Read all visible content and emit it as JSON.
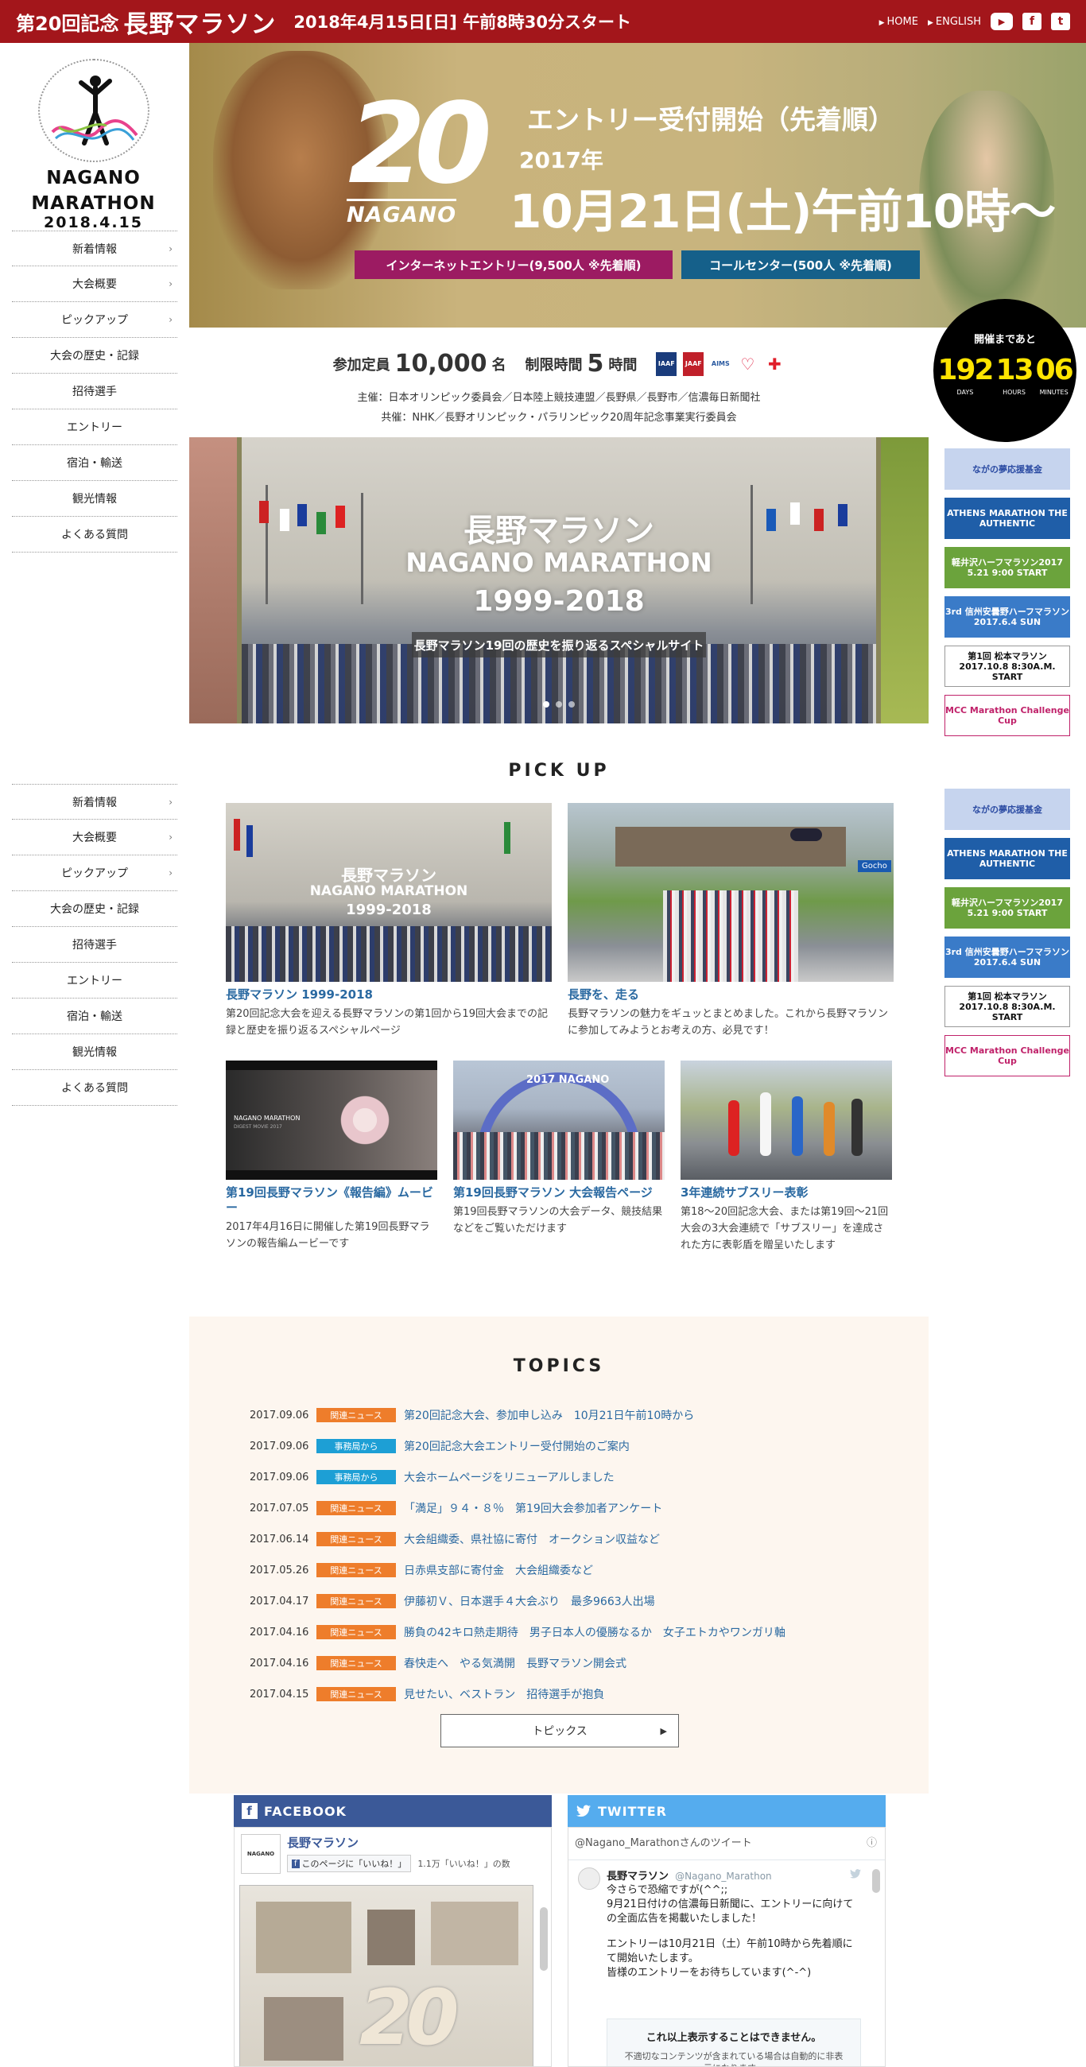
{
  "header": {
    "title_prefix": "第20回記念",
    "title_main": "長野マラソン",
    "date_text": "2018年4月15日[日] 午前8時30分スタート",
    "link_home": "HOME",
    "link_english": "ENGLISH",
    "youtube_label": "▶",
    "facebook_label": "f",
    "twitter_label": "t"
  },
  "logo": {
    "line1": "NAGANO",
    "line2": "MARATHON",
    "line3": "2018.4.15"
  },
  "nav": {
    "items": [
      {
        "label": "新着情報",
        "chevron": true
      },
      {
        "label": "大会概要",
        "chevron": true
      },
      {
        "label": "ピックアップ",
        "chevron": true
      },
      {
        "label": "大会の歴史・記録",
        "chevron": false
      },
      {
        "label": "招待選手",
        "chevron": false
      },
      {
        "label": "エントリー",
        "chevron": false
      },
      {
        "label": "宿泊・輸送",
        "chevron": false
      },
      {
        "label": "観光情報",
        "chevron": false
      },
      {
        "label": "よくある質問",
        "chevron": false
      }
    ],
    "chevron_glyph": "›"
  },
  "hero": {
    "big_number": "20",
    "nagano_word": "NAGANO",
    "headline": "エントリー受付開始（先着順）",
    "year": "2017年",
    "date_time": "10月21日(土)午前10時～",
    "btn_internet": "インターネットエントリー(9,500人 ※先着順)",
    "btn_callcenter": "コールセンター(500人 ※先着順)"
  },
  "countdown": {
    "label": "開催まであと",
    "days": "192",
    "hours": "13",
    "minutes": "06",
    "unit_days": "DAYS",
    "unit_hours": "HOURS",
    "unit_minutes": "MINUTES"
  },
  "info": {
    "capacity_label": "参加定員",
    "capacity_value": "10,000",
    "capacity_unit": "名",
    "limit_label": "制限時間",
    "limit_value": "5",
    "limit_unit": "時間",
    "organizers": "主催：日本オリンピック委員会／日本陸上競技連盟／長野県／長野市／信濃毎日新聞社",
    "cosponsors": "共催：NHK／長野オリンピック・パラリンピック20周年記念事業実行委員会",
    "logos": [
      "IAAF",
      "JAAF",
      "AIMS",
      "♡",
      "✚"
    ]
  },
  "slider": {
    "title_jp": "長野マラソン",
    "title_en": "NAGANO MARATHON",
    "years": "1999-2018",
    "caption": "長野マラソン19回の歴史を振り返るスペシャルサイト"
  },
  "pickup": {
    "title": "PICK UP",
    "cards": [
      {
        "title": "長野マラソン 1999-2018",
        "desc": "第20回記念大会を迎える長野マラソンの第1回から19回大会までの記録と歴史を振り返るスペシャルページ",
        "img_line1": "長野マラソン",
        "img_line2": "NAGANO MARATHON",
        "img_line3": "1999-2018"
      },
      {
        "title": "長野を、走る",
        "desc": "長野マラソンの魅力をギュッとまとめました。これから長野マラソンに参加してみようとお考えの方、必見です！",
        "img_sign": "Gocho"
      },
      {
        "title": "第19回長野マラソン《報告編》ムービー",
        "desc": "2017年4月16日に開催した第19回長野マラソンの報告編ムービーです",
        "img_line1": "NAGANO MARATHON",
        "img_line2": "DIGEST MOVIE 2017"
      },
      {
        "title": "第19回長野マラソン 大会報告ページ",
        "desc": "第19回長野マラソンの大会データ、競技結果などをご覧いただけます",
        "img_arch": "2017 NAGANO"
      },
      {
        "title": "3年連続サブスリー表彰",
        "desc": "第18～20回記念大会、または第19回～21回大会の3大会連続で「サブスリー」を達成された方に表彰盾を贈呈いたします"
      }
    ]
  },
  "topics": {
    "title": "TOPICS",
    "more_label": "トピックス",
    "more_arrow": "▶",
    "items": [
      {
        "date": "2017.09.06",
        "badge": "関連ニュース",
        "badge_color": "#ee7d2b",
        "text": "第20回記念大会、参加申し込み　10月21日午前10時から"
      },
      {
        "date": "2017.09.06",
        "badge": "事務局から",
        "badge_color": "#1d9fd5",
        "text": "第20回記念大会エントリー受付開始のご案内"
      },
      {
        "date": "2017.09.06",
        "badge": "事務局から",
        "badge_color": "#1d9fd5",
        "text": "大会ホームページをリニューアルしました"
      },
      {
        "date": "2017.07.05",
        "badge": "関連ニュース",
        "badge_color": "#ee7d2b",
        "text": "「満足」９４・８％　第19回大会参加者アンケート"
      },
      {
        "date": "2017.06.14",
        "badge": "関連ニュース",
        "badge_color": "#ee7d2b",
        "text": "大会組織委、県社協に寄付　オークション収益など"
      },
      {
        "date": "2017.05.26",
        "badge": "関連ニュース",
        "badge_color": "#ee7d2b",
        "text": "日赤県支部に寄付金　大会組織委など"
      },
      {
        "date": "2017.04.17",
        "badge": "関連ニュース",
        "badge_color": "#ee7d2b",
        "text": "伊藤初Ｖ、日本選手４大会ぶり　最多9663人出場"
      },
      {
        "date": "2017.04.16",
        "badge": "関連ニュース",
        "badge_color": "#ee7d2b",
        "text": "勝負の42キロ熱走期待　男子日本人の優勝なるか　女子エトカやワンガリ軸"
      },
      {
        "date": "2017.04.16",
        "badge": "関連ニュース",
        "badge_color": "#ee7d2b",
        "text": "春快走へ　やる気満開　長野マラソン開会式"
      },
      {
        "date": "2017.04.15",
        "badge": "関連ニュース",
        "badge_color": "#ee7d2b",
        "text": "見せたい、ベストラン　招待選手が抱負"
      }
    ]
  },
  "facebook": {
    "header": "FACEBOOK",
    "page_name": "長野マラソン",
    "like_label": "このページに「いいね！」",
    "like_count": "1.1万「いいね！」の数",
    "poster_big": "20"
  },
  "twitter": {
    "header": "TWITTER",
    "tweets_by": "@Nagano_Marathonさんのツイート",
    "info_icon": "ⓘ",
    "author_name": "長野マラソン",
    "author_handle": "@Nagano_Marathon",
    "tweet_line1": "今さらで恐縮ですが(^^;;",
    "tweet_line2": "9月21日付けの信濃毎日新聞に、エントリーに向けての全面広告を掲載いたしました！",
    "tweet_line3": "エントリーは10月21日（土）午前10時から先着順にて開始いたします。",
    "tweet_line4": "皆様のエントリーをお待ちしています(^-^)",
    "cannot_display": "これ以上表示することはできません。",
    "notice": "不適切なコンテンツが含まれている場合は自動的に非表示になります。"
  },
  "banners": [
    {
      "label": "ながの夢応援基金",
      "bg": "#c6d4ee",
      "fg": "#2a4aa2"
    },
    {
      "label": "ATHENS MARATHON THE AUTHENTIC",
      "bg": "#1f5ea8",
      "fg": "#ffffff"
    },
    {
      "label": "軽井沢ハーフマラソン2017 5.21 9:00 START",
      "bg": "#6ba33c",
      "fg": "#ffffff"
    },
    {
      "label": "3rd 信州安曇野ハーフマラソン 2017.6.4 SUN",
      "bg": "#3a7bc8",
      "fg": "#ffffff"
    },
    {
      "label": "第1回 松本マラソン 2017.10.8 8:30A.M. START",
      "bg": "#ffffff",
      "fg": "#111111"
    },
    {
      "label": "MCC Marathon Challenge Cup",
      "bg": "#ffffff",
      "fg": "#c0226a"
    }
  ]
}
